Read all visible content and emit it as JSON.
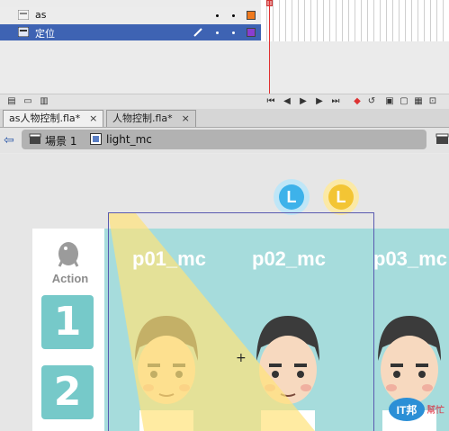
{
  "timeline": {
    "layers": [
      {
        "name": "as",
        "swatch_color": "#f07a1e",
        "selected": false
      },
      {
        "name": "定位",
        "swatch_color": "#8a3ed0",
        "selected": true
      }
    ]
  },
  "tabs": [
    {
      "label": "as人物控制.fla*",
      "active": true
    },
    {
      "label": "人物控制.fla*",
      "active": false
    }
  ],
  "editbar": {
    "scene": "場景 1",
    "symbol": "light_mc"
  },
  "stage": {
    "action_label": "Action",
    "buttons": [
      "1",
      "2"
    ],
    "mc_labels": [
      "p01_mc",
      "p02_mc",
      "p03_mc"
    ],
    "l_buttons": [
      {
        "text": "L",
        "color": "#3db2ea"
      },
      {
        "text": "L",
        "color": "#f3c534"
      }
    ],
    "watermark": {
      "main": "IT邦",
      "sub": "幫忙"
    }
  },
  "colors": {
    "teal_background": "#a6dcdc",
    "button_teal": "#76c9c9",
    "selection": "#3e63b3",
    "playhead": "#e03030"
  }
}
